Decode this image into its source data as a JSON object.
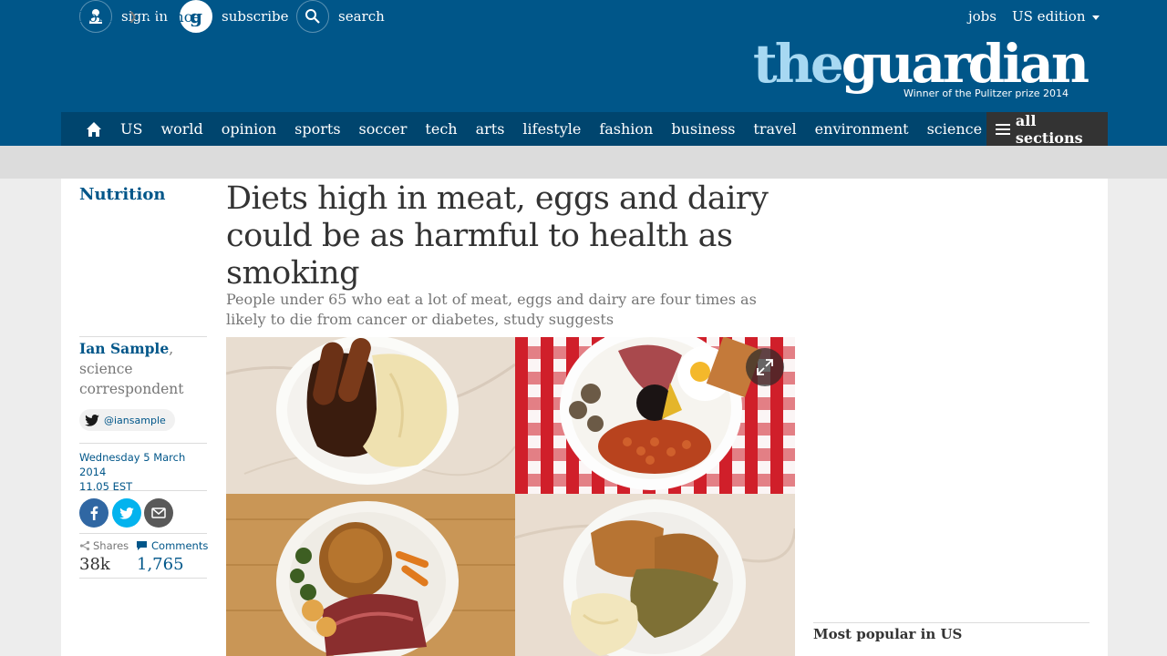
{
  "header": {
    "sign_in": "sign in",
    "subscribe": "subscribe",
    "search": "search",
    "jobs": "jobs",
    "edition": "US edition",
    "logo_the": "the",
    "logo_guardian": "guardian",
    "logo_tagline": "Winner of the Pulitzer prize 2014"
  },
  "nav": {
    "items": [
      "US",
      "world",
      "opinion",
      "sports",
      "soccer",
      "tech",
      "arts",
      "lifestyle",
      "fashion",
      "business",
      "travel",
      "environment",
      "science"
    ],
    "all_sections": "all sections"
  },
  "breadcrumb": {
    "home": "home",
    "section": "science"
  },
  "article": {
    "kicker": "Nutrition",
    "headline": "Diets high in meat, eggs and dairy could be as harmful to health as smoking",
    "standfirst": "People under 65 who eat a lot of meat, eggs and dairy are four times as likely to die from cancer or diabetes, study suggests",
    "author_name": "Ian Sample",
    "author_role": "science correspondent",
    "twitter_handle": "@iansample",
    "date": "Wednesday 5 March 2014",
    "time": "11.05 EST",
    "shares_label": "Shares",
    "shares_count": "38k",
    "comments_label": "Comments",
    "comments_count": "1,765"
  },
  "sidebar": {
    "most_popular": "Most popular in US"
  },
  "colors": {
    "brand_blue": "#005689",
    "nav_dark": "#00456e",
    "logo_light": "#a7d8f2"
  }
}
